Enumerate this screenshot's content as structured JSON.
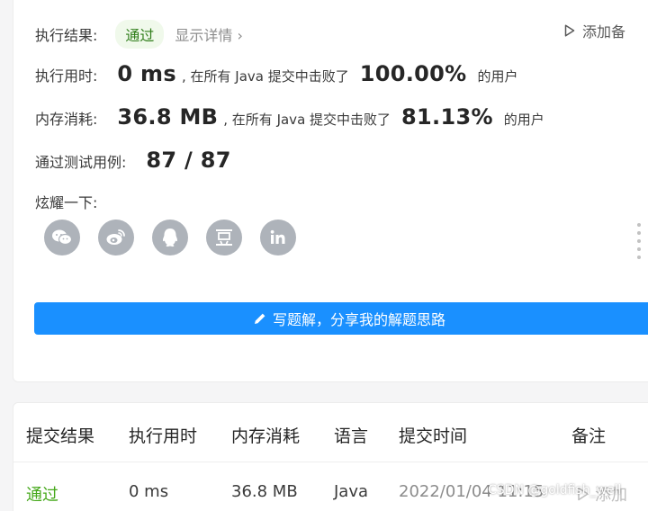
{
  "result": {
    "label": "执行结果:",
    "status": "通过",
    "detail_link": "显示详情",
    "note_link": "添加备"
  },
  "runtime": {
    "label": "执行用时:",
    "value": "0 ms",
    "mid_text": ", 在所有 Java 提交中击败了",
    "percent": "100.00%",
    "suffix": "的用户"
  },
  "memory": {
    "label": "内存消耗:",
    "value": "36.8 MB",
    "mid_text": ", 在所有 Java 提交中击败了",
    "percent": "81.13%",
    "suffix": "的用户"
  },
  "tests": {
    "label": "通过测试用例:",
    "value": "87 / 87"
  },
  "share": {
    "label": "炫耀一下:",
    "icons": [
      "wechat-icon",
      "weibo-icon",
      "qq-icon",
      "douban-icon",
      "linkedin-icon"
    ]
  },
  "write_button": "写题解，分享我的解题思路",
  "table": {
    "headers": [
      "提交结果",
      "执行用时",
      "内存消耗",
      "语言",
      "提交时间",
      "备注"
    ],
    "row": {
      "result": "通过",
      "runtime": "0 ms",
      "memory": "36.8 MB",
      "language": "Java",
      "time": "2022/01/04 11:15",
      "note": "添加"
    }
  },
  "watermark": "CSDN @goldfish_well",
  "colors": {
    "accent_blue": "#1a90ff",
    "pass_green": "#45a81a",
    "icon_gray": "#aeb3ba"
  }
}
